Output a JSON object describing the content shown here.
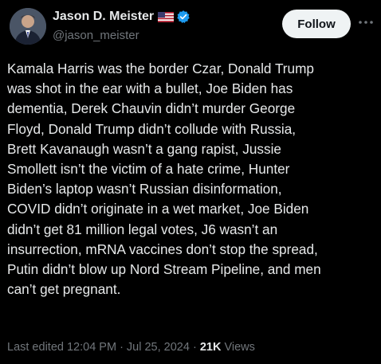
{
  "header": {
    "display_name": "Jason D. Meister",
    "handle": "@jason_meister",
    "follow_label": "Follow",
    "flag_icon": "us-flag-icon",
    "verified_icon": "verified-badge-icon",
    "more_icon": "more-options-icon",
    "verified_color": "#1d9bf0"
  },
  "tweet": {
    "text": "Kamala Harris was the border Czar, Donald Trump\nwas shot in the ear with a bullet, Joe Biden has\ndementia, Derek Chauvin didn’t murder George\nFloyd, Donald Trump didn’t collude with Russia,\nBrett Kavanaugh wasn’t a gang rapist, Jussie\nSmollett isn’t the victim of a hate crime, Hunter\nBiden’s laptop wasn’t Russian disinformation,\nCOVID didn’t originate in a wet market, Joe Biden\ndidn’t get 81 million legal votes, J6 wasn’t an\ninsurrection, mRNA vaccines don’t stop the spread,\nPutin didn’t blow up Nord Stream Pipeline, and men\ncan’t get pregnant."
  },
  "meta": {
    "edited": "Last edited 12:04 PM · Jul 25, 2024 · ",
    "views_count": "21K",
    "views_label": " Views"
  }
}
